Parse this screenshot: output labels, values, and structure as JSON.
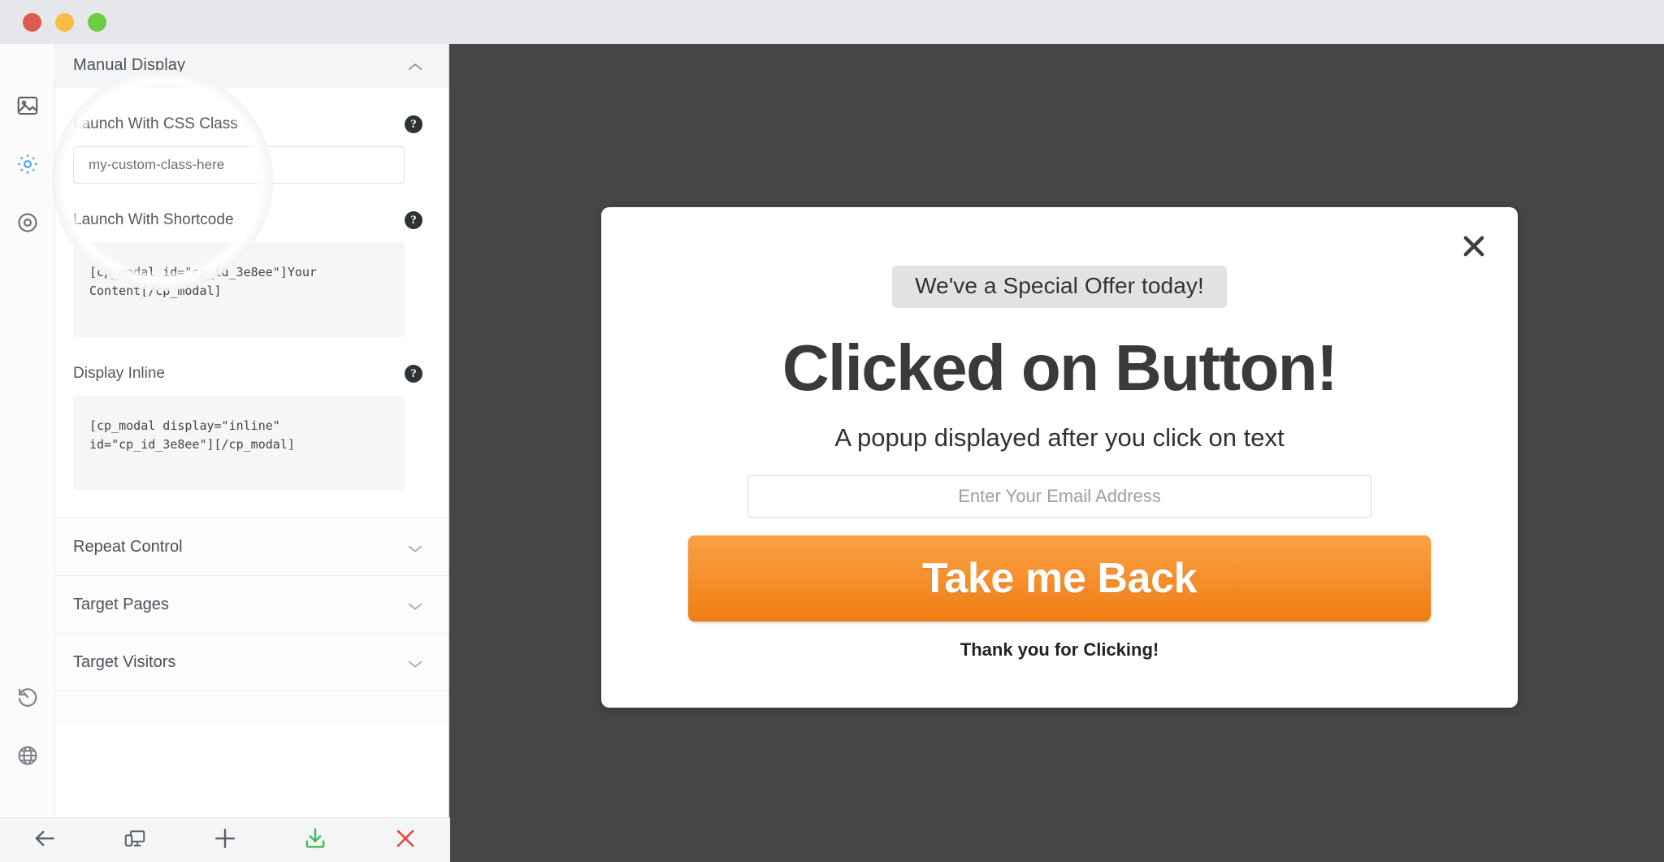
{
  "window": {
    "traffic_lights": [
      {
        "name": "close",
        "color": "#dd5b4d"
      },
      {
        "name": "minimize",
        "color": "#f9bd44"
      },
      {
        "name": "zoom",
        "color": "#6fcb3f"
      }
    ]
  },
  "rail": {
    "items_top": [
      {
        "icon": "image-icon",
        "active": false
      },
      {
        "icon": "gear-icon",
        "active": true
      },
      {
        "icon": "target-icon",
        "active": false
      }
    ],
    "items_bottom": [
      {
        "icon": "history-icon",
        "active": false
      },
      {
        "icon": "globe-icon",
        "active": false
      }
    ]
  },
  "sidebar": {
    "section": {
      "title": "Manual Display",
      "expanded": true,
      "chevron": "chevron-up-icon"
    },
    "fields": [
      {
        "label": "Launch With CSS Class",
        "help": "?",
        "type": "input",
        "value": "",
        "placeholder": "my-custom-class-here"
      },
      {
        "label": "Launch With Shortcode",
        "help": "?",
        "type": "code",
        "code": "[cp_modal id=\"cp_id_3e8ee\"]Your Content[/cp_modal]"
      },
      {
        "label": "Display Inline",
        "help": "?",
        "type": "code",
        "code": "[cp_modal display=\"inline\" id=\"cp_id_3e8ee\"][/cp_modal]"
      }
    ],
    "collapsed_sections": [
      {
        "title": "Repeat Control",
        "chevron": "chevron-down-icon"
      },
      {
        "title": "Target Pages",
        "chevron": "chevron-down-icon"
      },
      {
        "title": "Target Visitors",
        "chevron": "chevron-down-icon"
      }
    ]
  },
  "toolbar": {
    "buttons": [
      {
        "icon": "back-arrow-icon",
        "color": "#5a6066"
      },
      {
        "icon": "responsive-devices-icon",
        "color": "#5a6066"
      },
      {
        "icon": "plus-icon",
        "color": "#5a6066"
      },
      {
        "icon": "download-save-icon",
        "color": "#3fbf5f"
      },
      {
        "icon": "close-x-icon",
        "color": "#e04b3c"
      }
    ]
  },
  "modal": {
    "close_icon": "close-x-icon",
    "badge": "We've a Special Offer today!",
    "headline": "Clicked on Button!",
    "subhead": "A popup displayed after you click on text",
    "email_placeholder": "Enter Your Email Address",
    "email_value": "",
    "cta_label": "Take me Back",
    "thanks": "Thank you for Clicking!",
    "colors": {
      "cta_top": "#f9a145",
      "cta_bottom": "#ef7d12",
      "badge_bg": "#e2e2e2",
      "canvas_bg": "#474747"
    }
  }
}
